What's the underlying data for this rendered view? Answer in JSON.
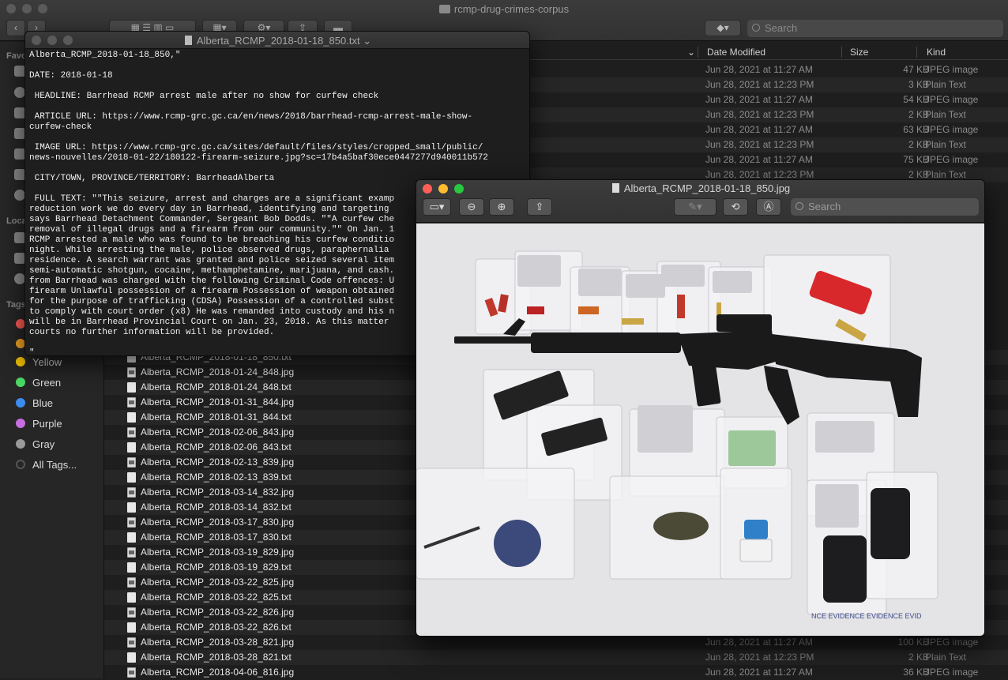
{
  "finder": {
    "title": "rcmp-drug-crimes-corpus",
    "search_placeholder": "Search",
    "sidebar": {
      "favorites_label": "Favo",
      "locations_label": "Loca",
      "tags_label": "Tags",
      "tags": [
        {
          "label": "Yellow",
          "color": "#f5c400"
        },
        {
          "label": "Green",
          "color": "#4cd964"
        },
        {
          "label": "Blue",
          "color": "#3b8ef0"
        },
        {
          "label": "Purple",
          "color": "#c86ee0"
        },
        {
          "label": "Gray",
          "color": "#9a9a9a"
        },
        {
          "label": "All Tags...",
          "color": "#555555"
        }
      ]
    },
    "columns": {
      "date_modified": "Date Modified",
      "size": "Size",
      "kind": "Kind"
    },
    "rows_top": [
      {
        "date": "Jun 28, 2021 at 11:27 AM",
        "size": "47 KB",
        "kind": "JPEG image"
      },
      {
        "date": "Jun 28, 2021 at 12:23 PM",
        "size": "3 KB",
        "kind": "Plain Text"
      },
      {
        "date": "Jun 28, 2021 at 11:27 AM",
        "size": "54 KB",
        "kind": "JPEG image"
      },
      {
        "date": "Jun 28, 2021 at 12:23 PM",
        "size": "2 KB",
        "kind": "Plain Text"
      },
      {
        "date": "Jun 28, 2021 at 11:27 AM",
        "size": "63 KB",
        "kind": "JPEG image"
      },
      {
        "date": "Jun 28, 2021 at 12:23 PM",
        "size": "2 KB",
        "kind": "Plain Text"
      },
      {
        "date": "Jun 28, 2021 at 11:27 AM",
        "size": "75 KB",
        "kind": "JPEG image"
      },
      {
        "date": "Jun 28, 2021 at 12:23 PM",
        "size": "2 KB",
        "kind": "Plain Text"
      }
    ],
    "rows_bottom": [
      {
        "name": "Alberta_RCMP_2018-01-18_850.txt",
        "type": "txt",
        "date": "",
        "size": "",
        "kind": ""
      },
      {
        "name": "Alberta_RCMP_2018-01-24_848.jpg",
        "type": "jpg",
        "date": "",
        "size": "",
        "kind": ""
      },
      {
        "name": "Alberta_RCMP_2018-01-24_848.txt",
        "type": "txt",
        "date": "",
        "size": "",
        "kind": ""
      },
      {
        "name": "Alberta_RCMP_2018-01-31_844.jpg",
        "type": "jpg",
        "date": "",
        "size": "",
        "kind": ""
      },
      {
        "name": "Alberta_RCMP_2018-01-31_844.txt",
        "type": "txt",
        "date": "",
        "size": "",
        "kind": ""
      },
      {
        "name": "Alberta_RCMP_2018-02-06_843.jpg",
        "type": "jpg",
        "date": "",
        "size": "",
        "kind": ""
      },
      {
        "name": "Alberta_RCMP_2018-02-06_843.txt",
        "type": "txt",
        "date": "",
        "size": "",
        "kind": ""
      },
      {
        "name": "Alberta_RCMP_2018-02-13_839.jpg",
        "type": "jpg",
        "date": "",
        "size": "",
        "kind": ""
      },
      {
        "name": "Alberta_RCMP_2018-02-13_839.txt",
        "type": "txt",
        "date": "",
        "size": "",
        "kind": ""
      },
      {
        "name": "Alberta_RCMP_2018-03-14_832.jpg",
        "type": "jpg",
        "date": "",
        "size": "",
        "kind": ""
      },
      {
        "name": "Alberta_RCMP_2018-03-14_832.txt",
        "type": "txt",
        "date": "",
        "size": "",
        "kind": ""
      },
      {
        "name": "Alberta_RCMP_2018-03-17_830.jpg",
        "type": "jpg",
        "date": "",
        "size": "",
        "kind": ""
      },
      {
        "name": "Alberta_RCMP_2018-03-17_830.txt",
        "type": "txt",
        "date": "",
        "size": "",
        "kind": ""
      },
      {
        "name": "Alberta_RCMP_2018-03-19_829.jpg",
        "type": "jpg",
        "date": "",
        "size": "",
        "kind": ""
      },
      {
        "name": "Alberta_RCMP_2018-03-19_829.txt",
        "type": "txt",
        "date": "",
        "size": "",
        "kind": ""
      },
      {
        "name": "Alberta_RCMP_2018-03-22_825.jpg",
        "type": "jpg",
        "date": "",
        "size": "",
        "kind": ""
      },
      {
        "name": "Alberta_RCMP_2018-03-22_825.txt",
        "type": "txt",
        "date": "",
        "size": "",
        "kind": ""
      },
      {
        "name": "Alberta_RCMP_2018-03-22_826.jpg",
        "type": "jpg",
        "date": "",
        "size": "",
        "kind": ""
      },
      {
        "name": "Alberta_RCMP_2018-03-22_826.txt",
        "type": "txt",
        "date": "",
        "size": "",
        "kind": ""
      },
      {
        "name": "Alberta_RCMP_2018-03-28_821.jpg",
        "type": "jpg",
        "date": "Jun 28, 2021 at 11:27 AM",
        "size": "100 KB",
        "kind": "JPEG image"
      },
      {
        "name": "Alberta_RCMP_2018-03-28_821.txt",
        "type": "txt",
        "date": "Jun 28, 2021 at 12:23 PM",
        "size": "2 KB",
        "kind": "Plain Text"
      },
      {
        "name": "Alberta_RCMP_2018-04-06_816.jpg",
        "type": "jpg",
        "date": "Jun 28, 2021 at 11:27 AM",
        "size": "36 KB",
        "kind": "JPEG image"
      }
    ]
  },
  "textedit": {
    "title": "Alberta_RCMP_2018-01-18_850.txt",
    "lines": [
      "Alberta_RCMP_2018-01-18_850,\"",
      "",
      "DATE: 2018-01-18",
      "",
      " HEADLINE: Barrhead RCMP arrest male after no show for curfew check",
      "",
      " ARTICLE URL: https://www.rcmp-grc.gc.ca/en/news/2018/barrhead-rcmp-arrest-male-show-",
      "curfew-check",
      "",
      " IMAGE URL: https://www.rcmp-grc.gc.ca/sites/default/files/styles/cropped_small/public/",
      "news-nouvelles/2018-01-22/180122-firearm-seizure.jpg?sc=17b4a5baf30ece0447277d940011b572",
      "",
      " CITY/TOWN, PROVINCE/TERRITORY: BarrheadAlberta",
      "",
      " FULL TEXT: \"\"This seizure, arrest and charges are a significant examp",
      "reduction work we do every day in Barrhead, identifying and targeting",
      "says Barrhead Detachment Commander, Sergeant Bob Dodds. \"\"A curfew che",
      "removal of illegal drugs and a firearm from our community.\"\" On Jan. 1",
      "RCMP arrested a male who was found to be breaching his curfew conditio",
      "night. While arresting the male, police observed drugs, paraphernalia",
      "residence. A search warrant was granted and police seized several item",
      "semi-automatic shotgun, cocaine, methamphetamine, marijuana, and cash.",
      "from Barrhead was charged with the following Criminal Code offences: U",
      "firearm Unlawful possession of a firearm Possession of weapon obtained",
      "for the purpose of trafficking (CDSA) Possession of a controlled subst",
      "to comply with court order (x8) He was remanded into custody and his n",
      "will be in Barrhead Provincial Court on Jan. 23, 2018. As this matter",
      "courts no further information will be provided.",
      "",
      "\""
    ]
  },
  "preview": {
    "title": "Alberta_RCMP_2018-01-18_850.jpg",
    "search_placeholder": "Search",
    "evidence_text": "NCE EVIDENCE EVIDENCE EVID"
  }
}
